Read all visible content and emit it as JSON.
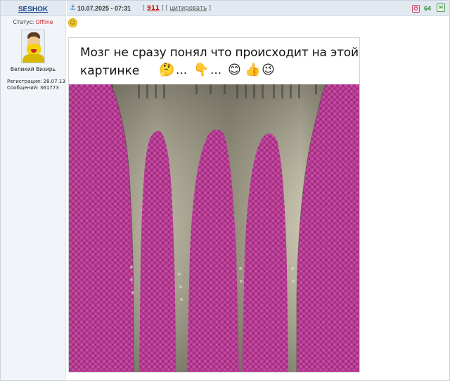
{
  "author": {
    "name": "SESHOK",
    "status_label": "Статус:",
    "status_value": "Offline",
    "rank": "Великий Визирь",
    "registration": "Регистрация: 28.07.13",
    "messages": "Сообщений: 361773"
  },
  "post": {
    "anchor_icon": "anchor-icon",
    "date": "10.07.2025 - 07:31",
    "bracket_open": "[",
    "comment_count": "911",
    "separator": "] [",
    "quote_label": "цитировать",
    "bracket_close": "]",
    "rating_icon": "vote-icon",
    "rating_value": "64",
    "pm_icon": "message-icon",
    "emoji": "smile-emoji"
  },
  "image": {
    "caption_line1": "Мозг не сразу понял что происходит на этой",
    "caption_line2": "картинке",
    "caption_emojis": [
      "🤔",
      "...",
      "👇",
      "...",
      "😊",
      "👍",
      "😉"
    ]
  },
  "colors": {
    "towel": "#b2378f",
    "towel_dark": "#8e2470",
    "metal": "#9c9886",
    "link": "#1a4a8a",
    "offline": "#d02020",
    "rating": "#2f8a2f"
  }
}
